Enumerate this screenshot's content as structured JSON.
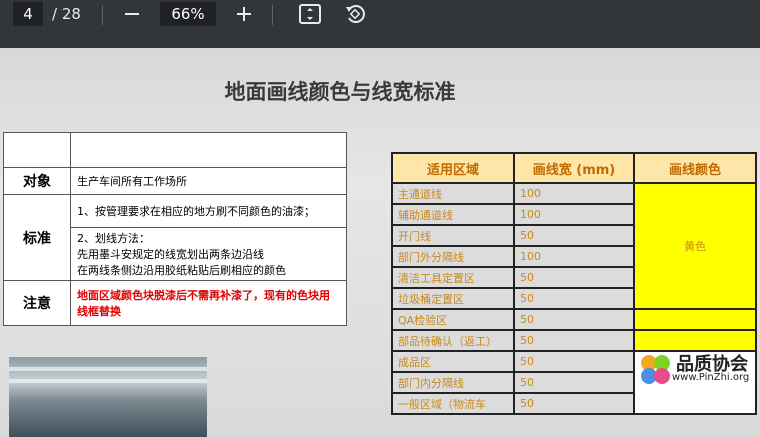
{
  "toolbar": {
    "page_current": "4",
    "page_total": "/ 28",
    "zoom": "66%"
  },
  "document": {
    "title": "地面画线颜色与线宽标准",
    "left_table": {
      "rows": [
        {
          "key": "对象",
          "value": "生产车间所有工作场所"
        },
        {
          "key": "标准",
          "value1": "1、按管理要求在相应的地方刷不同颜色的油漆；",
          "value2a": "2、划线方法：",
          "value2b": "先用墨斗安规定的线宽划出两条边沿线",
          "value2c": "在两线条侧边沿用胶纸粘贴后刷相应的颜色"
        },
        {
          "key": "注意",
          "value": "地面区域颜色块脱漆后不需再补漆了，现有的色块用线框替换"
        }
      ]
    },
    "right_table": {
      "headers": [
        "适用区域",
        "画线宽 (mm)",
        "画线颜色"
      ],
      "rows": [
        {
          "area": "主通道线",
          "width": "100"
        },
        {
          "area": "辅助通道线",
          "width": "100"
        },
        {
          "area": "开门线",
          "width": "50"
        },
        {
          "area": "部门外分隔线",
          "width": "100"
        },
        {
          "area": "清洁工具定置区",
          "width": "50"
        },
        {
          "area": "垃圾桶定置区",
          "width": "50"
        },
        {
          "area": "QA检验区",
          "width": "50"
        },
        {
          "area": "部品待确认（返工）",
          "width": "50"
        },
        {
          "area": "成品区",
          "width": "50"
        },
        {
          "area": "部门内分隔线",
          "width": "50"
        },
        {
          "area": "一般区域（物流车",
          "width": "50"
        }
      ],
      "color_label": "黄色"
    }
  },
  "watermark": {
    "text": "品质协会",
    "url": "www.PinZhi.org"
  }
}
